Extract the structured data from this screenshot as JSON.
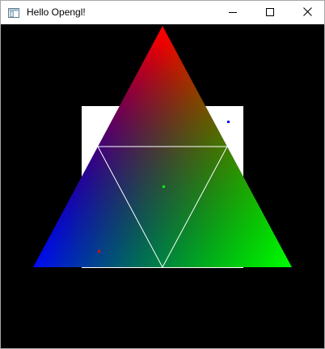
{
  "window": {
    "title": "Hello Opengl!",
    "minimize_icon": "minimize-icon",
    "maximize_icon": "maximize-icon",
    "close_icon": "close-icon",
    "app_icon": "window-app-icon"
  },
  "scene": {
    "background_color": "#000000",
    "quad_color": "#ffffff",
    "outline_color": "#ffffff",
    "vertex_colors": {
      "top": "#ff0000",
      "bottom_left": "#0000ff",
      "bottom_right": "#00ff00"
    },
    "point_colors": {
      "red": "#ff0000",
      "green": "#00ff00",
      "blue": "#0000ff"
    }
  }
}
